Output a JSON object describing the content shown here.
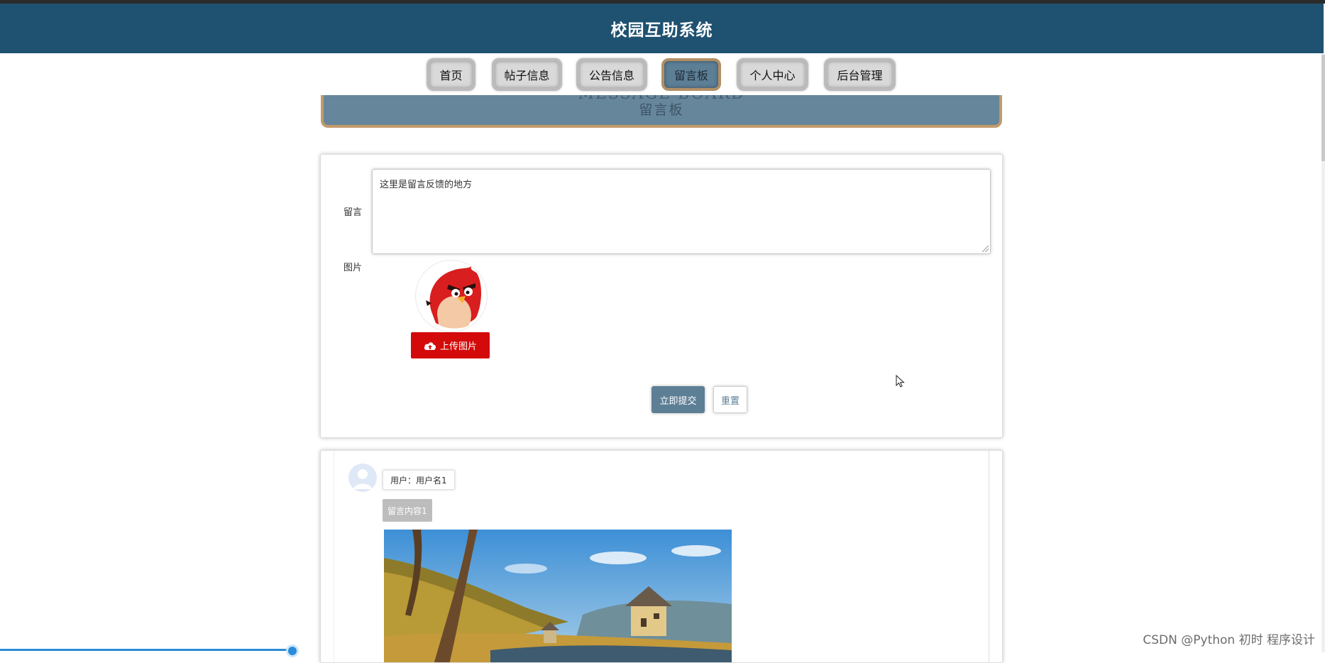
{
  "app": {
    "title": "校园互助系统"
  },
  "nav": {
    "items": [
      {
        "label": "首页",
        "active": false
      },
      {
        "label": "帖子信息",
        "active": false
      },
      {
        "label": "公告信息",
        "active": false
      },
      {
        "label": "留言板",
        "active": true
      },
      {
        "label": "个人中心",
        "active": false
      },
      {
        "label": "后台管理",
        "active": false
      }
    ]
  },
  "banner": {
    "title_en": "MESSAGE BOARD",
    "title": "留言板"
  },
  "form": {
    "message_label": "留言",
    "message_placeholder": "这里是留言反馈的地方",
    "image_label": "图片",
    "upload_label": "上传图片",
    "submit_label": "立即提交",
    "reset_label": "重置"
  },
  "comments": [
    {
      "user": "用户：用户名1",
      "content": "留言内容1"
    }
  ],
  "watermark": "CSDN @Python 初时 程序设计",
  "colors": {
    "header": "#1f5170",
    "accent": "#5d7f96",
    "upload": "#d40a0a",
    "banner_border": "#c39a6b"
  }
}
